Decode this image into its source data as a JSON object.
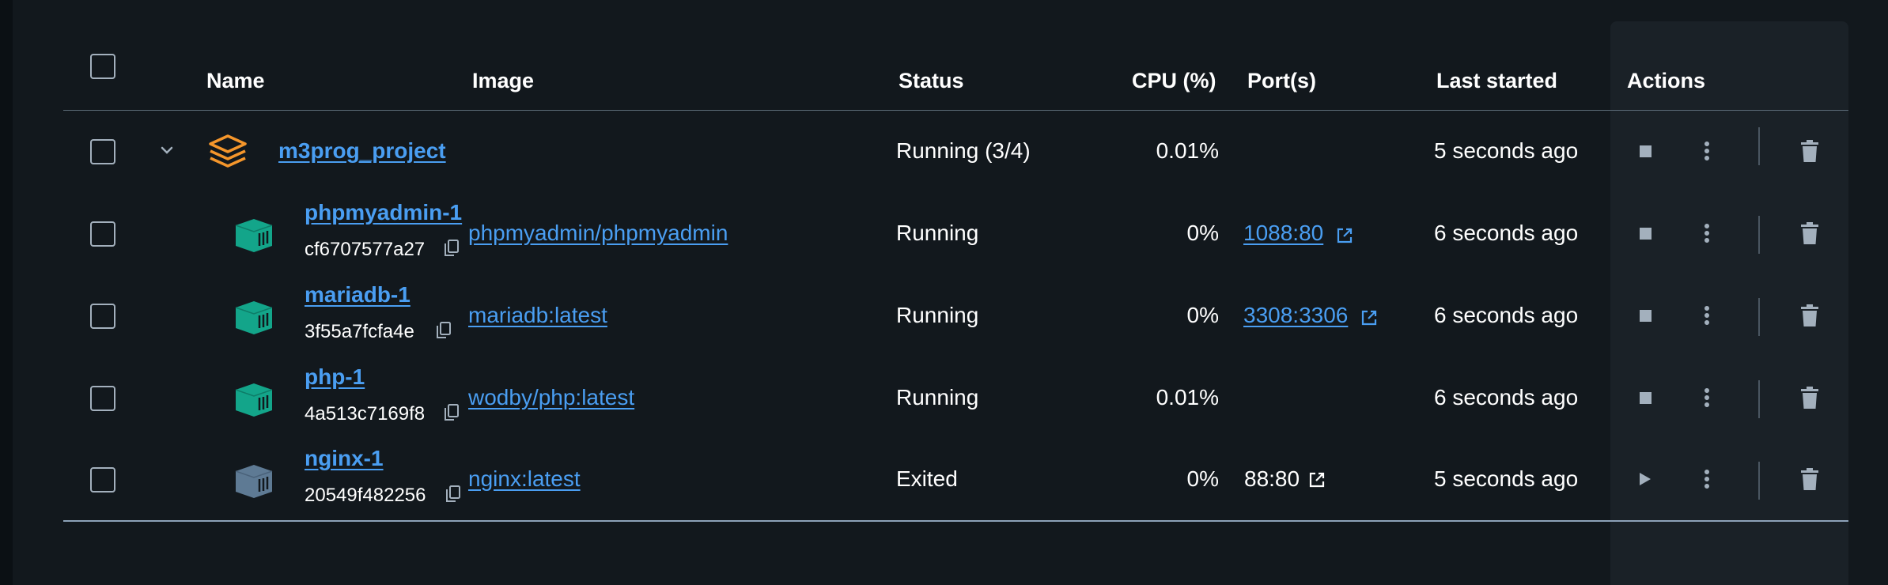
{
  "header": {
    "name": "Name",
    "image": "Image",
    "status": "Status",
    "cpu": "CPU (%)",
    "ports": "Port(s)",
    "last_started": "Last started",
    "actions": "Actions"
  },
  "project": {
    "name": "m3prog_project",
    "status": "Running (3/4)",
    "cpu": "0.01%",
    "last_started": "5 seconds ago"
  },
  "containers": [
    {
      "name": "phpmyadmin-1",
      "id": "cf6707577a27",
      "image": "phpmyadmin/phpmyadmin",
      "status": "Running",
      "cpu": "0%",
      "port": "1088:80",
      "last_started": "6 seconds ago"
    },
    {
      "name": "mariadb-1",
      "id": "3f55a7fcfa4e",
      "image": "mariadb:latest",
      "status": "Running",
      "cpu": "0%",
      "port": "3308:3306",
      "last_started": "6 seconds ago"
    },
    {
      "name": "php-1",
      "id": "4a513c7169f8",
      "image": "wodby/php:latest",
      "status": "Running",
      "cpu": "0.01%",
      "port": "",
      "last_started": "6 seconds ago"
    },
    {
      "name": "nginx-1",
      "id": "20549f482256",
      "image": "nginx:latest",
      "status": "Exited",
      "cpu": "0%",
      "port": "88:80",
      "last_started": "5 seconds ago"
    }
  ],
  "colors": {
    "background": "#12181d",
    "link": "#4a9ef2",
    "running_icon": "#13a58a",
    "exited_icon": "#5e7a94",
    "project_icon": "#f5962b"
  }
}
